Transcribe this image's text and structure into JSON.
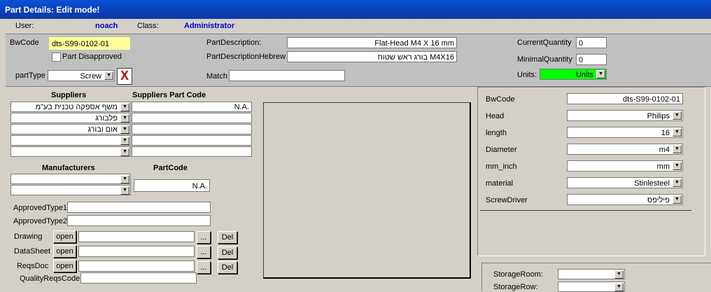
{
  "window": {
    "title": "Part Details: Edit mode!"
  },
  "user": {
    "user_label": "User:",
    "user_value": "noach",
    "class_label": "Class:",
    "class_value": "Administrator"
  },
  "top": {
    "bwcode_label": "BwCode",
    "bwcode_value": "dts-S99-0102-01",
    "part_disapproved_label": "Part Disapproved",
    "parttype_label": "partType",
    "parttype_value": "Screw",
    "partdescription_label": "PartDescription:",
    "partdescription_value": "Flat-Head M4 X 16 mm",
    "partdescription_hebrew_label": "PartDescriptionHebrew",
    "partdescription_hebrew_value": "בורג ראש שטוח M4X16",
    "match_label": "Match",
    "match_value": "",
    "currentquantity_label": "CurrentQuantity",
    "currentquantity_value": "0",
    "minimalquantity_label": "MinimalQuantity",
    "minimalquantity_value": "0",
    "units_label": "Units:",
    "units_value": "Units",
    "units_color": "#00ff00",
    "delete_color": "#c00000"
  },
  "suppliers": {
    "header_suppliers": "Suppliers",
    "header_code": "Suppliers Part Code",
    "rows": [
      {
        "name": "משף אספקה טכנית בע\"מ",
        "code": "N.A."
      },
      {
        "name": "פלבורג",
        "code": ""
      },
      {
        "name": "אום ובורג",
        "code": ""
      },
      {
        "name": "",
        "code": ""
      },
      {
        "name": "",
        "code": ""
      }
    ]
  },
  "manufacturers": {
    "header_manufacturers": "Manufacturers",
    "header_partcode": "PartCode",
    "rows": [
      {
        "name": ""
      },
      {
        "name": ""
      }
    ],
    "partcode_value": "N.A."
  },
  "approved": {
    "type1_label": "ApprovedType1",
    "type1_value": "",
    "type2_label": "ApprovedType2",
    "type2_value": ""
  },
  "docs": {
    "open_label": "open",
    "browse_label": "...",
    "del_label": "Del",
    "drawing_label": "Drawing",
    "datasheet_label": "DataSheet",
    "reqsdoc_label": "ReqsDoc",
    "qualityreqscode_label": "QualityReqsCode",
    "qualityreqscode_value": ""
  },
  "attributes": {
    "bwcode_label": "BwCode",
    "bwcode_value": "dts-S99-0102-01",
    "head_label": "Head",
    "head_value": "Philips",
    "length_label": "length",
    "length_value": "16",
    "diameter_label": "Diameter",
    "diameter_value": "m4",
    "mminch_label": "mm_inch",
    "mminch_value": "mm",
    "material_label": "material",
    "material_value": "Stinlesteel",
    "screwdriver_label": "ScrewDriver",
    "screwdriver_value": "פיליפס"
  },
  "storage": {
    "room_label": "StorageRoom:",
    "room_value": "",
    "row_label": "StorageRow:",
    "row_value": ""
  }
}
